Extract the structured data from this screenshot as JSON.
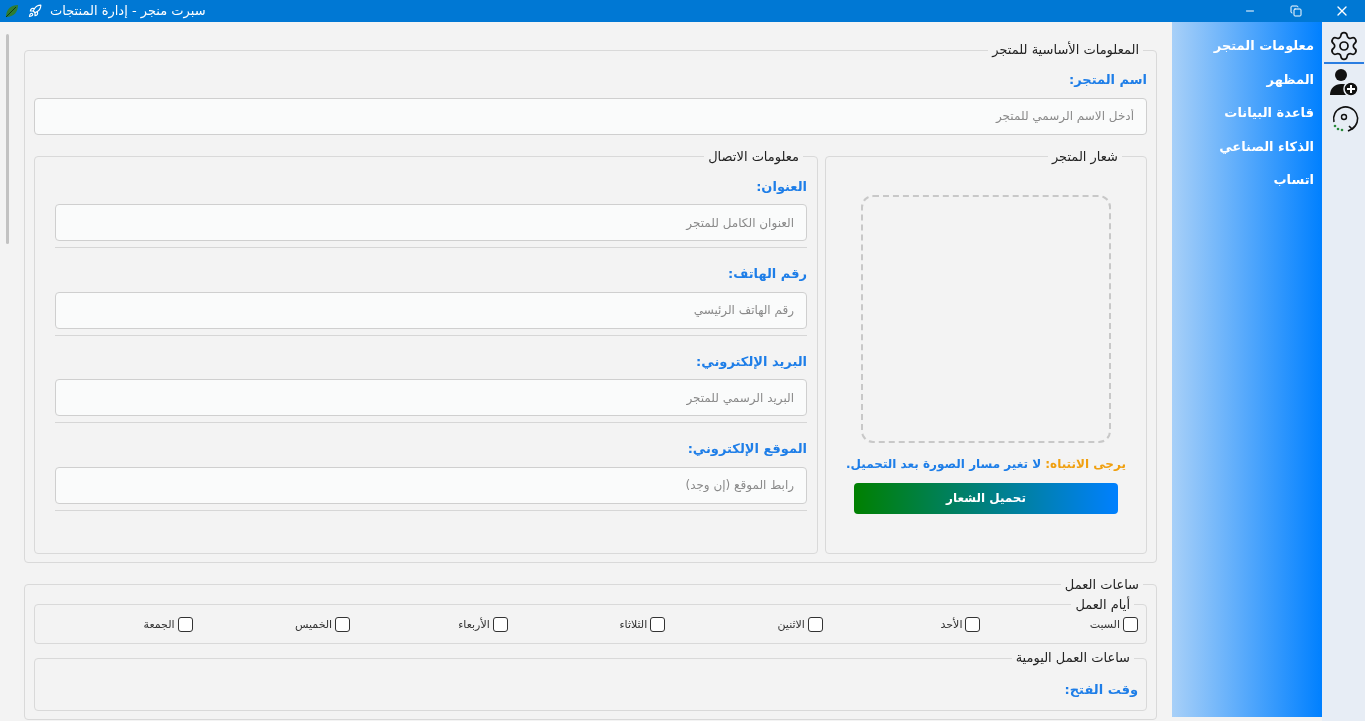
{
  "window": {
    "title": "سبرت منجر - إدارة المنتجات"
  },
  "icon_strip": [
    {
      "kind": "gear",
      "selected": true
    },
    {
      "kind": "user-add",
      "selected": false
    },
    {
      "kind": "sync",
      "selected": false
    }
  ],
  "sidebar": {
    "items": [
      {
        "label": "معلومات المتجر"
      },
      {
        "label": "المظهر"
      },
      {
        "label": "قاعدة البيانات"
      },
      {
        "label": "الذكاء الصناعي"
      },
      {
        "label": "اتساب"
      }
    ]
  },
  "basic_info": {
    "legend": "المعلومات الأساسية للمتجر",
    "store_name": {
      "label": "اسم المتجر:",
      "placeholder": "أدخل الاسم الرسمي للمتجر"
    },
    "contact": {
      "legend": "معلومات الاتصال",
      "fields": [
        {
          "label": "العنوان:",
          "placeholder": "العنوان الكامل للمتجر"
        },
        {
          "label": "رقم الهاتف:",
          "placeholder": "رقم الهاتف الرئيسي"
        },
        {
          "label": "البريد الإلكتروني:",
          "placeholder": "البريد الرسمي للمتجر"
        },
        {
          "label": "الموقع الإلكتروني:",
          "placeholder": "رابط الموقع (إن وجد)"
        }
      ]
    },
    "logo": {
      "legend": "شعار المتجر",
      "notice": {
        "label": "يرجى الانتباه:",
        "text": "لا تغير مسار الصورة بعد التحميل."
      },
      "button": "تحميل الشعار"
    }
  },
  "hours": {
    "legend": "ساعات العمل",
    "days": {
      "legend": "أيام العمل",
      "items": [
        {
          "label": "السبت",
          "checked": false
        },
        {
          "label": "الأحد",
          "checked": false
        },
        {
          "label": "الاثنين",
          "checked": false
        },
        {
          "label": "الثلاثاء",
          "checked": false
        },
        {
          "label": "الأربعاء",
          "checked": false
        },
        {
          "label": "الخميس",
          "checked": false
        },
        {
          "label": "الجمعة",
          "checked": false
        }
      ]
    },
    "daily": {
      "legend": "ساعات العمل اليومية",
      "fields": [
        {
          "label": "وقت الفتح:"
        }
      ]
    }
  }
}
